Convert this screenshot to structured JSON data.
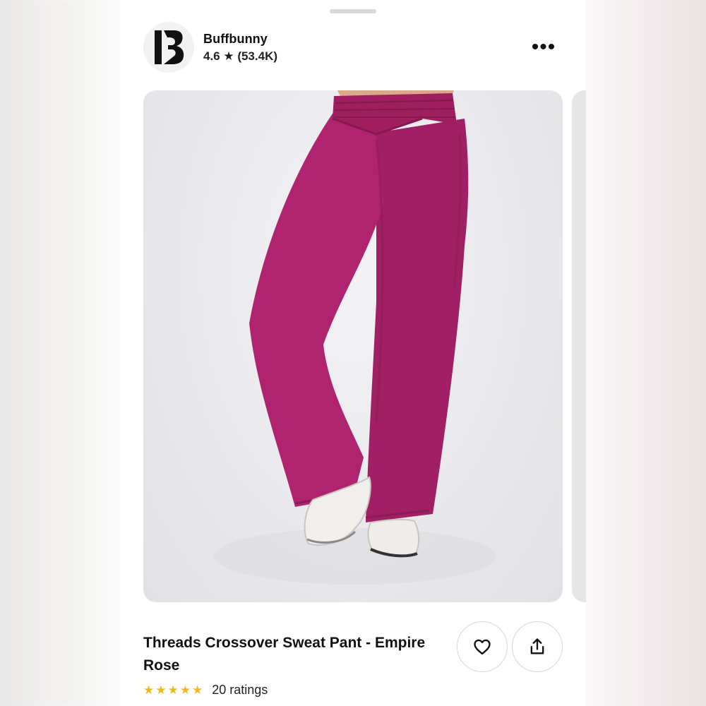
{
  "brand": {
    "name": "Buffbunny",
    "logo_letters": "B",
    "rating_text": "4.6 ★ (53.4K)"
  },
  "header": {
    "more_icon": "more-horizontal-icon",
    "more_label": "•••"
  },
  "product": {
    "title": "Threads Crossover Sweat Pant - Empire Rose",
    "image_color": "#b0246f",
    "ratings_stars": 5,
    "ratings_text": "20 ratings",
    "star_glyph": "★",
    "star_color": "#f2b81d"
  },
  "actions": {
    "save_icon": "heart-icon",
    "share_icon": "share-icon"
  }
}
